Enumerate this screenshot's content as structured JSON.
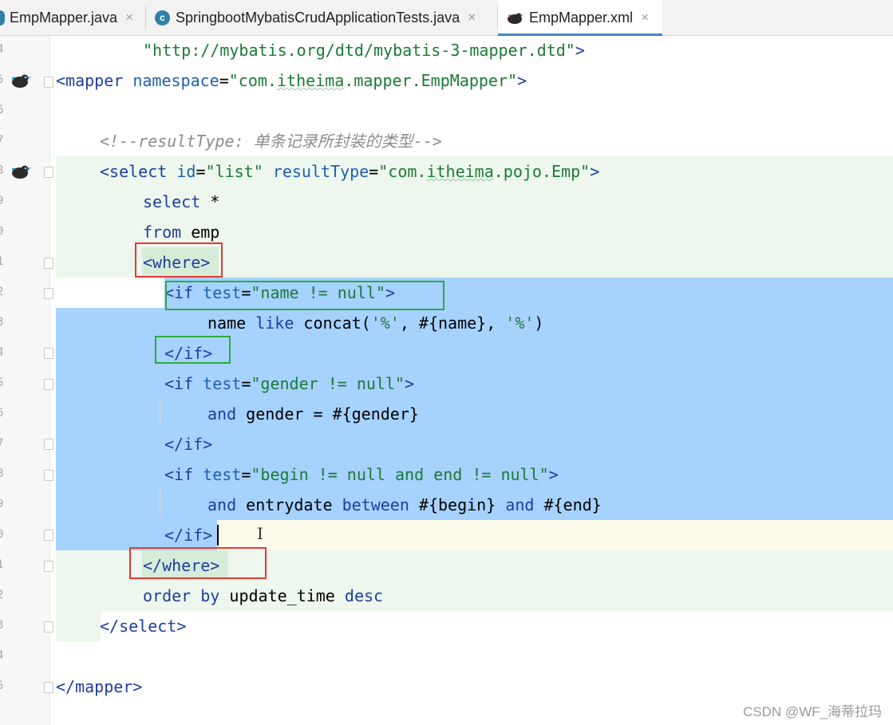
{
  "tabs": [
    {
      "label": "EmpMapper.java",
      "close": "×",
      "icon": "java-class-icon"
    },
    {
      "label": "SpringbootMybatisCrudApplicationTests.java",
      "close": "×",
      "icon": "java-test-class-icon",
      "icon_glyph": "c"
    },
    {
      "label": "EmpMapper.xml",
      "close": "×",
      "icon": "mybatis-bird-icon"
    }
  ],
  "gutter": {
    "line_numbers": [
      "4",
      "5",
      "6",
      "7",
      "8",
      "9",
      "0",
      "1",
      "2",
      "3",
      "4",
      "5",
      "6",
      "7",
      "8",
      "9",
      "0",
      "1",
      "2",
      "3",
      "4",
      "5"
    ]
  },
  "code": {
    "l1": {
      "v": "\"http://mybatis.org/dtd/mybatis-3-mapper.dtd\"",
      "e": ">"
    },
    "l2": {
      "o": "<mapper",
      "a": "namespace",
      "eq": "=",
      "v1": "\"com.",
      "v2": "itheima",
      "v3": ".mapper.EmpMapper\"",
      "e": ">"
    },
    "l4": "<!--resultType: 单条记录所封装的类型-->",
    "l5": {
      "o": "<select",
      "a1": "id",
      "eq1": "=",
      "v1": "\"list\"",
      "a2": "resultType",
      "eq2": "=",
      "v2a": "\"com.",
      "v2b": "itheima",
      "v2c": ".pojo.Emp\"",
      "e": ">"
    },
    "l6": {
      "k": "select",
      "r": " *"
    },
    "l7": {
      "k": "from",
      "r": " emp"
    },
    "l8": "<where>",
    "l9": {
      "o": "<if",
      "a": "test",
      "eq": "=",
      "v": "\"name != null\"",
      "e": ">"
    },
    "l10": {
      "k": "name",
      "s1": " ",
      "k2": "like",
      "r1": " concat(",
      "q1": "'%'",
      "r2": ", #{name}, ",
      "q2": "'%'",
      "r3": ")"
    },
    "l11": "</if>",
    "l12": {
      "o": "<if",
      "a": "test",
      "eq": "=",
      "v": "\"gender != null\"",
      "e": ">"
    },
    "l13": {
      "k": "and",
      "r": " gender = #{gender}"
    },
    "l14": "</if>",
    "l15": {
      "o": "<if",
      "a": "test",
      "eq": "=",
      "v": "\"begin != null and end != null\"",
      "e": ">"
    },
    "l16": {
      "k": "and",
      "r1": " entrydate ",
      "k2": "between",
      "r2": " #{begin} ",
      "k3": "and",
      "r3": " #{end}"
    },
    "l17": "</if>",
    "l18": "</where>",
    "l19": {
      "k1": "order",
      "s": " ",
      "k2": "by",
      "r": " update_time ",
      "k3": "desc"
    },
    "l20": "</select>",
    "l22": "</mapper>"
  },
  "watermark": "CSDN @WF_海蒂拉玛",
  "colors": {
    "selection": "#a6d2ff",
    "scope_highlight": "#edf7ed",
    "current_line": "#fffbeb",
    "annotation_red": "#e53935",
    "annotation_green": "#2eaa3c",
    "active_tab_underline": "#4a86c8"
  }
}
